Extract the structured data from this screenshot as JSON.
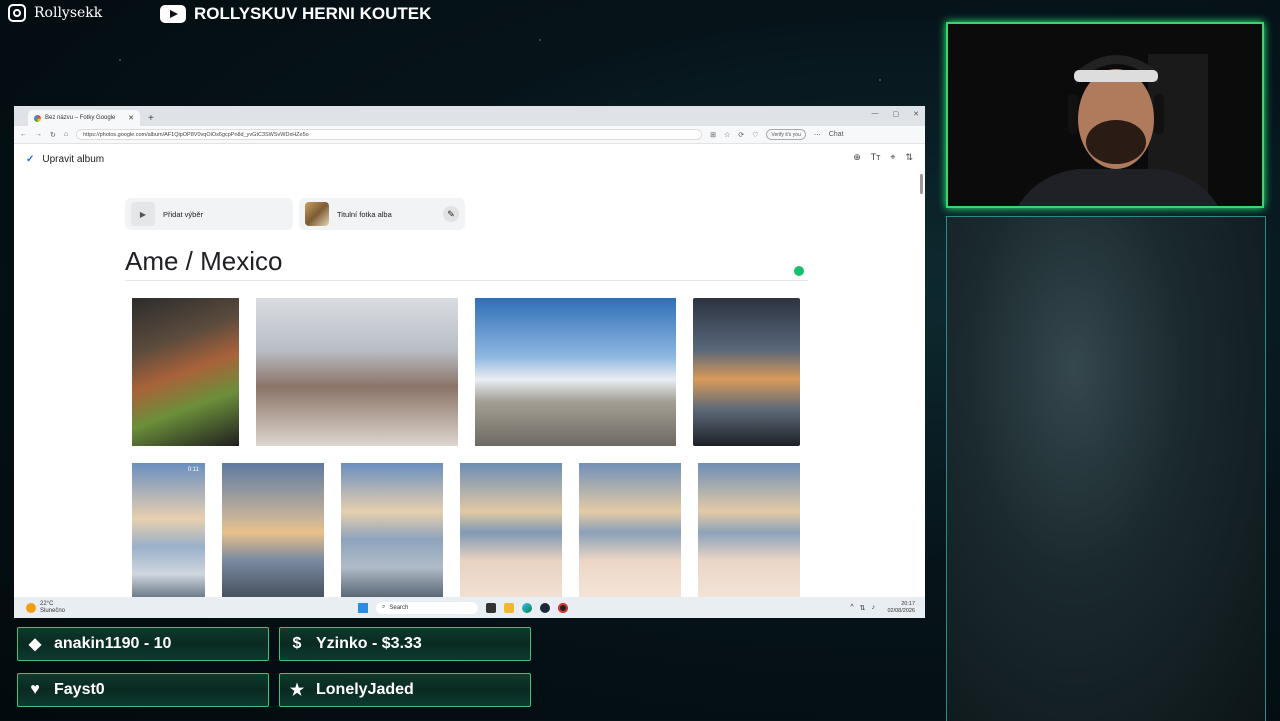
{
  "overlay": {
    "instagram": "Rollysekk",
    "youtube": "ROLLYSKUV HERNI KOUTEK",
    "alerts": [
      {
        "icon": "diamond-icon",
        "text": "anakin1190 - 10"
      },
      {
        "icon": "dollar-icon",
        "text": "Yzinko - $3.33"
      },
      {
        "icon": "heart-icon",
        "text": "Fayst0"
      },
      {
        "icon": "star-icon",
        "text": "LonelyJaded"
      }
    ]
  },
  "browser": {
    "tab_title": "Bez názvu – Fotky Google",
    "url": "https://photos.google.com/album/AF1QipOP8V0vqOiOs6gcpPn8d_yvGtC3SWSvWDxHZe5o",
    "verify": "Verify it's you",
    "chat": "Chat"
  },
  "album": {
    "edit_label": "Upravit album",
    "add_selection": "Přidat výběr",
    "cover_photo": "Titulní fotka alba",
    "title": "Ame / Mexico",
    "video_duration": "0:11"
  },
  "taskbar": {
    "temp": "22°C",
    "weather": "Slunečno",
    "search": "Search",
    "time": "20:17",
    "date": "02/08/2026"
  }
}
